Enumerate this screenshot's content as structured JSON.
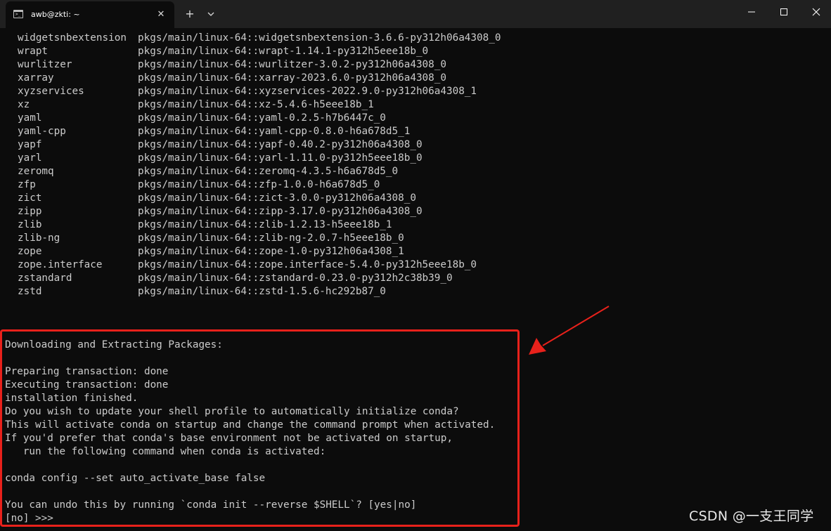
{
  "window": {
    "tab_title": "awb@zkti: ~",
    "icons": {
      "tab": "terminal-icon",
      "close_tab": "close-icon",
      "new_tab": "plus-icon",
      "dropdown": "chevron-down-icon",
      "minimize": "minimize-icon",
      "maximize": "maximize-icon",
      "close": "close-icon"
    }
  },
  "packages": [
    {
      "name": "widgetsnbextension",
      "source": "pkgs/main/linux-64::widgetsnbextension-3.6.6-py312h06a4308_0"
    },
    {
      "name": "wrapt",
      "source": "pkgs/main/linux-64::wrapt-1.14.1-py312h5eee18b_0"
    },
    {
      "name": "wurlitzer",
      "source": "pkgs/main/linux-64::wurlitzer-3.0.2-py312h06a4308_0"
    },
    {
      "name": "xarray",
      "source": "pkgs/main/linux-64::xarray-2023.6.0-py312h06a4308_0"
    },
    {
      "name": "xyzservices",
      "source": "pkgs/main/linux-64::xyzservices-2022.9.0-py312h06a4308_1"
    },
    {
      "name": "xz",
      "source": "pkgs/main/linux-64::xz-5.4.6-h5eee18b_1"
    },
    {
      "name": "yaml",
      "source": "pkgs/main/linux-64::yaml-0.2.5-h7b6447c_0"
    },
    {
      "name": "yaml-cpp",
      "source": "pkgs/main/linux-64::yaml-cpp-0.8.0-h6a678d5_1"
    },
    {
      "name": "yapf",
      "source": "pkgs/main/linux-64::yapf-0.40.2-py312h06a4308_0"
    },
    {
      "name": "yarl",
      "source": "pkgs/main/linux-64::yarl-1.11.0-py312h5eee18b_0"
    },
    {
      "name": "zeromq",
      "source": "pkgs/main/linux-64::zeromq-4.3.5-h6a678d5_0"
    },
    {
      "name": "zfp",
      "source": "pkgs/main/linux-64::zfp-1.0.0-h6a678d5_0"
    },
    {
      "name": "zict",
      "source": "pkgs/main/linux-64::zict-3.0.0-py312h06a4308_0"
    },
    {
      "name": "zipp",
      "source": "pkgs/main/linux-64::zipp-3.17.0-py312h06a4308_0"
    },
    {
      "name": "zlib",
      "source": "pkgs/main/linux-64::zlib-1.2.13-h5eee18b_1"
    },
    {
      "name": "zlib-ng",
      "source": "pkgs/main/linux-64::zlib-ng-2.0.7-h5eee18b_0"
    },
    {
      "name": "zope",
      "source": "pkgs/main/linux-64::zope-1.0-py312h06a4308_1"
    },
    {
      "name": "zope.interface",
      "source": "pkgs/main/linux-64::zope.interface-5.4.0-py312h5eee18b_0"
    },
    {
      "name": "zstandard",
      "source": "pkgs/main/linux-64::zstandard-0.23.0-py312h2c38b39_0"
    },
    {
      "name": "zstd",
      "source": "pkgs/main/linux-64::zstd-1.5.6-hc292b87_0"
    }
  ],
  "output": {
    "downloading": "Downloading and Extracting Packages:",
    "preparing": "Preparing transaction: done",
    "executing": "Executing transaction: done",
    "finished": "installation finished.",
    "question": "Do you wish to update your shell profile to automatically initialize conda?",
    "activate_note": "This will activate conda on startup and change the command prompt when activated.",
    "prefer_note": "If you'd prefer that conda's base environment not be activated on startup,",
    "run_note": "   run the following command when conda is activated:",
    "config_command": "conda config --set auto_activate_base false",
    "undo_note": "You can undo this by running `conda init --reverse $SHELL`? [yes|no]",
    "prompt": "[no] >>> "
  },
  "annotation": {
    "box_color": "#e8211b",
    "arrow_color": "#e8211b"
  },
  "watermark": "CSDN @一支王同学"
}
